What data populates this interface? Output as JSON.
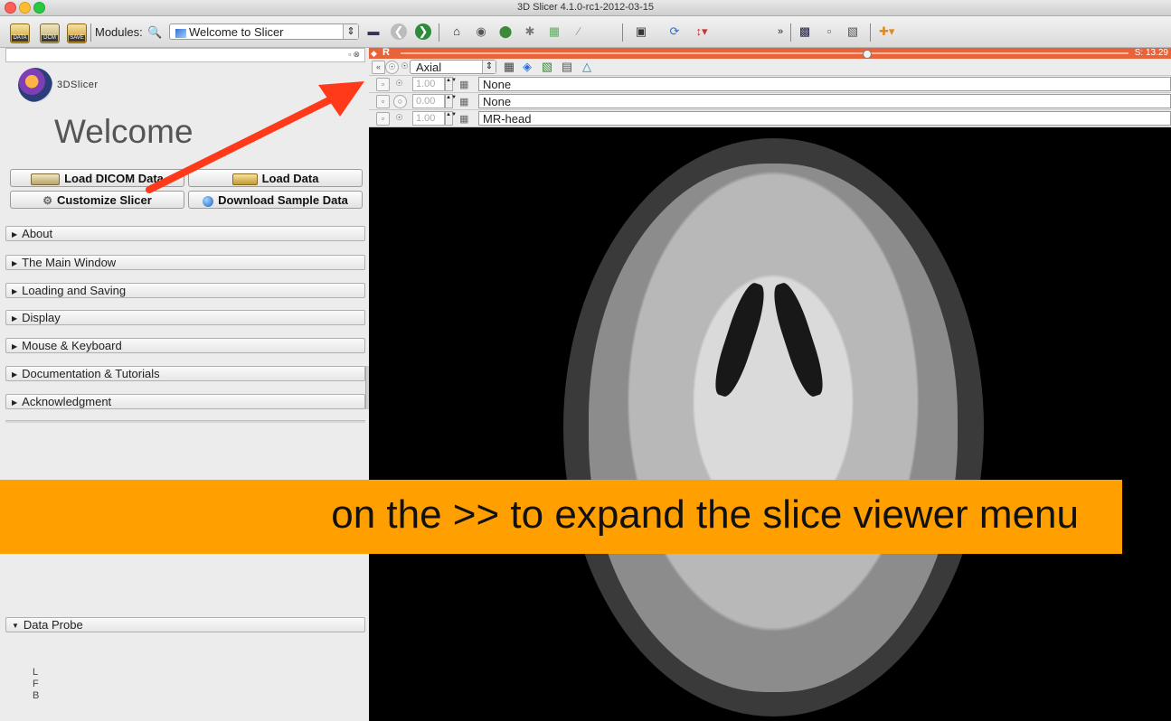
{
  "window": {
    "title": "3D Slicer 4.1.0-rc1-2012-03-15"
  },
  "toolbar": {
    "data_label": "DATA",
    "dcm_label": "DCM",
    "save_label": "SAVE",
    "modules_label": "Modules:",
    "module_selected": "Welcome to Slicer"
  },
  "welcome_panel": {
    "logo_text": "3DSlicer",
    "heading": "Welcome",
    "buttons": {
      "load_dicom": "Load DICOM Data",
      "load_data": "Load Data",
      "customize": "Customize Slicer",
      "download_sample": "Download Sample Data"
    },
    "sections": [
      "About",
      "The Main Window",
      "Loading and Saving",
      "Display",
      "Mouse & Keyboard",
      "Documentation & Tutorials",
      "Acknowledgment"
    ],
    "data_probe": {
      "label": "Data Probe",
      "lines": [
        "L",
        "F",
        "B"
      ]
    }
  },
  "slice_viewer": {
    "view_label": "R",
    "offset_value": "S: 13.29",
    "slider_fraction": 0.64,
    "collapse_button": "«",
    "orientation": "Axial",
    "layers": [
      {
        "opacity": "1.00",
        "volume": "None"
      },
      {
        "opacity": "0.00",
        "volume": "None"
      },
      {
        "opacity": "1.00",
        "volume": "MR-head"
      }
    ]
  },
  "annotation": {
    "caption": "on the >> to expand the slice viewer menu",
    "caption_color": "#ffa000",
    "arrow_color": "#ff3a1a"
  }
}
